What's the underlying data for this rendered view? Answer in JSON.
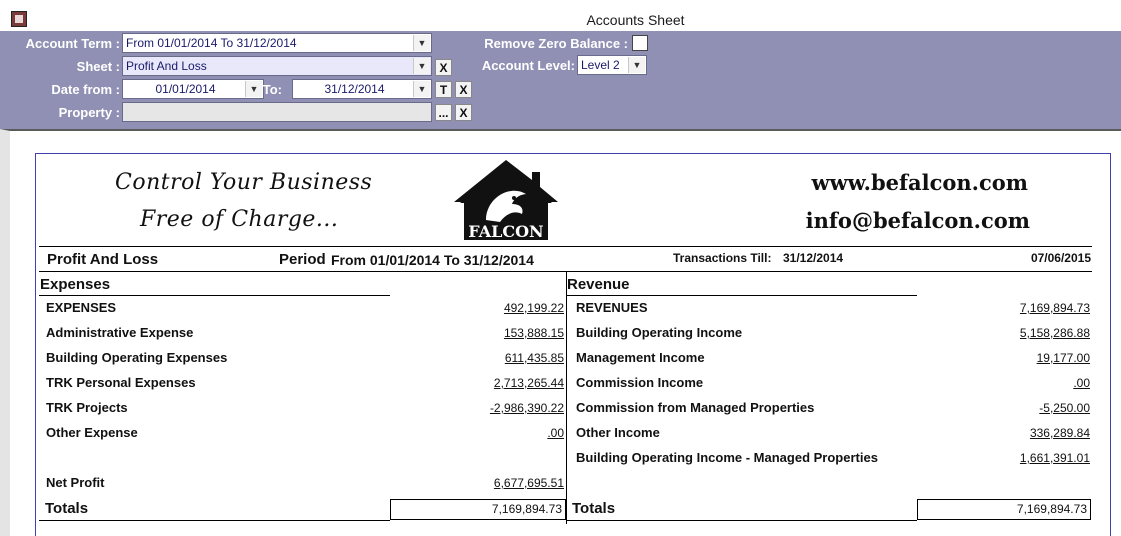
{
  "window": {
    "title": "Accounts Sheet",
    "icon": "app-icon"
  },
  "filters": {
    "account_term": {
      "label": "Account Term :",
      "value": "From 01/01/2014 To 31/12/2014"
    },
    "sheet": {
      "label": "Sheet :",
      "value": "Profit And Loss",
      "clear_label": "X"
    },
    "date_from": {
      "label": "Date from :",
      "value": "01/01/2014"
    },
    "date_to": {
      "label": "To:",
      "value": "31/12/2014",
      "today_label": "T",
      "clear_label": "X"
    },
    "property": {
      "label": "Property :",
      "value": "",
      "browse_label": "...",
      "clear_label": "X"
    },
    "remove_zero_balance": {
      "label": "Remove Zero Balance :",
      "checked": false
    },
    "account_level": {
      "label": "Account Level:",
      "value": "Level 2"
    }
  },
  "report": {
    "slogan_line1": "Control Your Business",
    "slogan_line2": "Free of Charge...",
    "logo_text": "FALCON",
    "website": "www.befalcon.com",
    "email": "info@befalcon.com",
    "sheet_title": "Profit And Loss",
    "period_label": "Period",
    "period_value": "From 01/01/2014 To 31/12/2014",
    "transactions_label": "Transactions Till:",
    "transactions_value": "31/12/2014",
    "report_date": "07/06/2015",
    "expenses": {
      "header": "Expenses",
      "rows": [
        {
          "label": "EXPENSES",
          "amount": "492,199.22"
        },
        {
          "label": "Administrative Expense",
          "amount": "153,888.15"
        },
        {
          "label": "Building Operating Expenses",
          "amount": "611,435.85"
        },
        {
          "label": "TRK Personal Expenses",
          "amount": "2,713,265.44"
        },
        {
          "label": "TRK Projects",
          "amount": "-2,986,390.22"
        },
        {
          "label": "Other Expense",
          "amount": ".00"
        }
      ],
      "net_profit_label": "Net Profit",
      "net_profit_amount": "6,677,695.51",
      "totals_label": "Totals",
      "totals_amount": "7,169,894.73"
    },
    "revenue": {
      "header": "Revenue",
      "rows": [
        {
          "label": "REVENUES",
          "amount": "7,169,894.73"
        },
        {
          "label": "Building Operating Income",
          "amount": "5,158,286.88"
        },
        {
          "label": "Management Income",
          "amount": "19,177.00"
        },
        {
          "label": "Commission Income",
          "amount": ".00"
        },
        {
          "label": "Commission from Managed Properties",
          "amount": "-5,250.00"
        },
        {
          "label": "Other Income",
          "amount": "336,289.84"
        },
        {
          "label": "Building Operating Income - Managed Properties",
          "amount": "1,661,391.01"
        }
      ],
      "totals_label": "Totals",
      "totals_amount": "7,169,894.73"
    }
  }
}
